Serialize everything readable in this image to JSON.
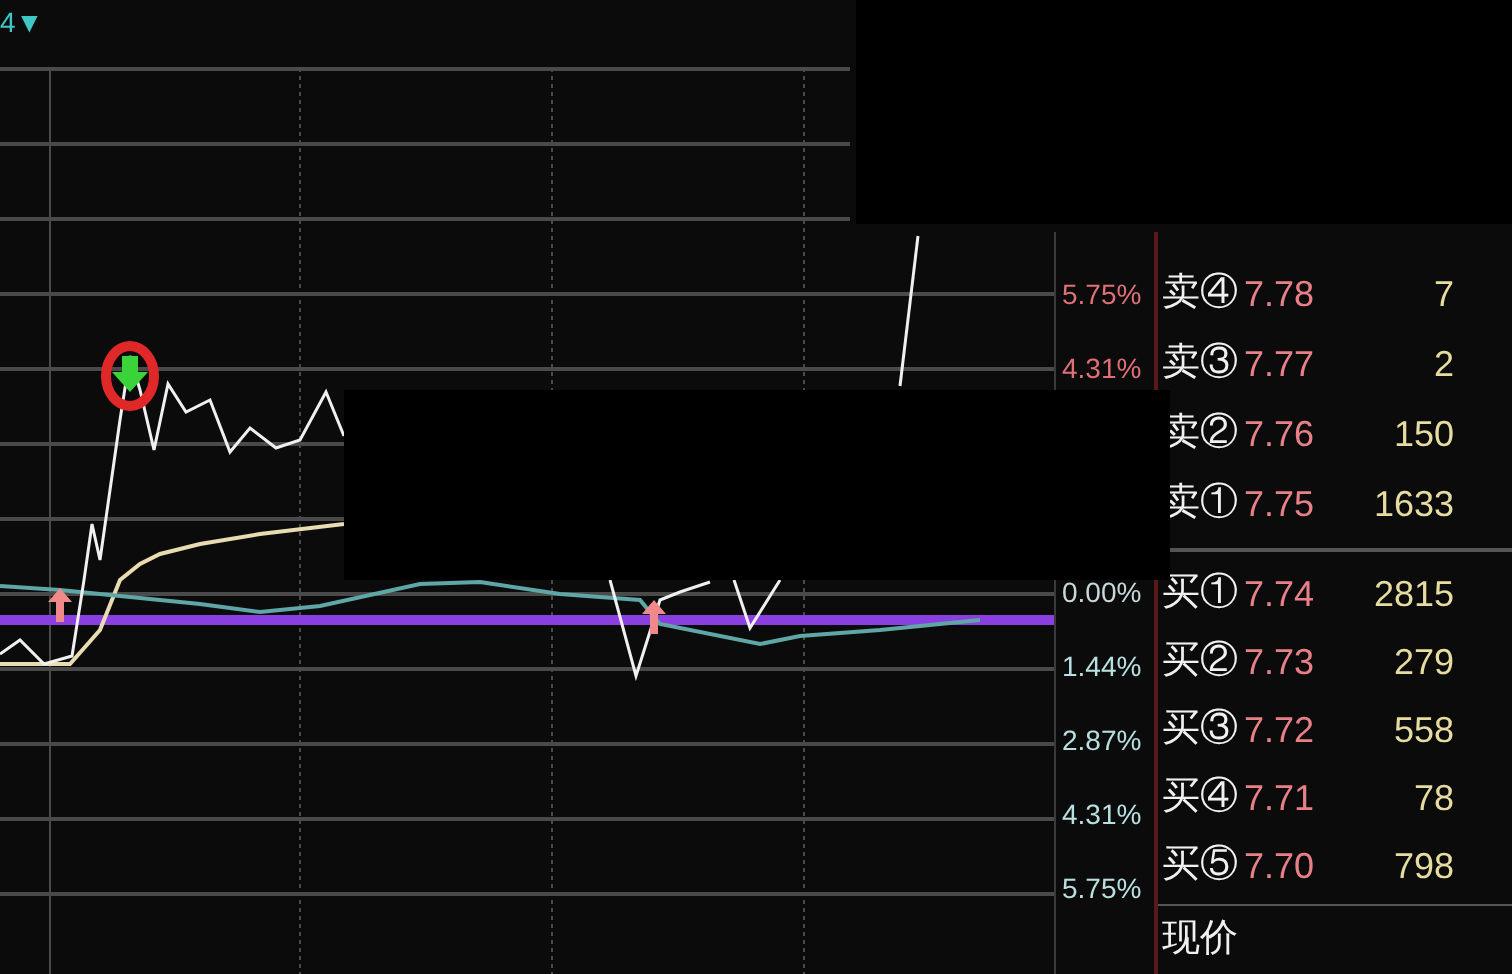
{
  "header": {
    "period_label": "4▼"
  },
  "axis_labels": [
    {
      "text": "5.75%",
      "kind": "up"
    },
    {
      "text": "4.31%",
      "kind": "up"
    },
    {
      "text": "0.00%",
      "kind": "zero"
    },
    {
      "text": "1.44%",
      "kind": "down"
    },
    {
      "text": "2.87%",
      "kind": "down"
    },
    {
      "text": "4.31%",
      "kind": "down"
    },
    {
      "text": "5.75%",
      "kind": "down"
    }
  ],
  "order_book": {
    "asks": [
      {
        "label": "卖④",
        "price": "7.78",
        "volume": "7"
      },
      {
        "label": "卖③",
        "price": "7.77",
        "volume": "2"
      },
      {
        "label": "卖②",
        "price": "7.76",
        "volume": "150"
      },
      {
        "label": "卖①",
        "price": "7.75",
        "volume": "1633"
      }
    ],
    "bids": [
      {
        "label": "买①",
        "price": "7.74",
        "volume": "2815"
      },
      {
        "label": "买②",
        "price": "7.73",
        "volume": "279"
      },
      {
        "label": "买③",
        "price": "7.72",
        "volume": "558"
      },
      {
        "label": "买④",
        "price": "7.71",
        "volume": "78"
      },
      {
        "label": "买⑤",
        "price": "7.70",
        "volume": "798"
      }
    ],
    "current_price_label": "现价"
  }
}
